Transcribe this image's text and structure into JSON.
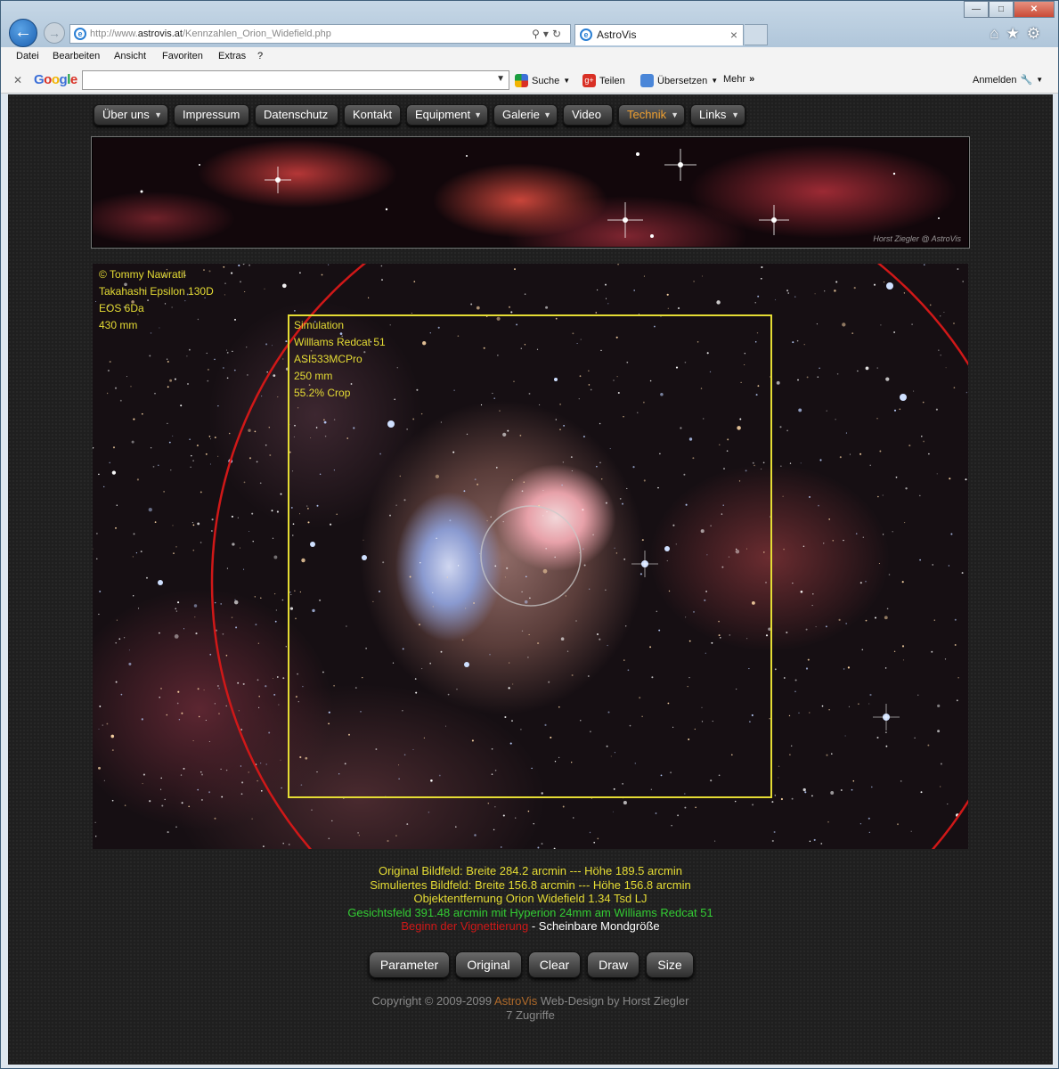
{
  "browser": {
    "url_prefix": "http://www.",
    "url_domain": "astrovis.at",
    "url_path": "/Kennzahlen_Orion_Widefield.php",
    "tab_title": "AstroVis",
    "menu": [
      "Datei",
      "Bearbeiten",
      "Ansicht",
      "Favoriten",
      "Extras",
      "?"
    ],
    "google": {
      "logo": "Google",
      "search_label": "Suche",
      "share_label": "Teilen",
      "translate_label": "Übersetzen",
      "more_label": "Mehr",
      "signin_label": "Anmelden"
    }
  },
  "nav": [
    "Über uns",
    "Impressum",
    "Datenschutz",
    "Kontakt",
    "Equipment",
    "Galerie",
    "Video",
    "Technik",
    "Links"
  ],
  "nav_active": "Technik",
  "banner_signature": "Horst Ziegler @ AstroVis",
  "image_caption": [
    "© Tommy Nawratil",
    "Takahashi Epsilon 130D",
    "EOS 6Da",
    "430 mm"
  ],
  "simulation_caption": [
    "Simulation",
    "Williams Redcat 51",
    "ASI533MCPro",
    "250 mm",
    "55.2% Crop"
  ],
  "info": {
    "original_field": "Original Bildfeld: Breite 284.2 arcmin --- Höhe 189.5 arcmin",
    "simulated_field": "Simuliertes Bildfeld: Breite 156.8 arcmin --- Höhe 156.8 arcmin",
    "distance": "Objektentfernung Orion Widefield 1.34 Tsd LJ",
    "fov": "Gesichtsfeld 391.48 arcmin mit Hyperion 24mm am Williams Redcat 51",
    "vignette": "Beginn der Vignettierung",
    "separator": " - ",
    "moon": "Scheinbare Mondgröße"
  },
  "buttons": [
    "Parameter",
    "Original",
    "Clear",
    "Draw",
    "Size"
  ],
  "footer": {
    "copyright_pre": "Copyright © 2009-2099 ",
    "brand": "AstroVis",
    "copyright_post": " Web-Design by Horst Ziegler",
    "visits": "7 Zugriffe"
  },
  "colors": {
    "caption_yellow": "#e5dc34",
    "fov_green": "#33cc33",
    "vignette_red": "#d01818",
    "active_nav": "#f0a030"
  }
}
